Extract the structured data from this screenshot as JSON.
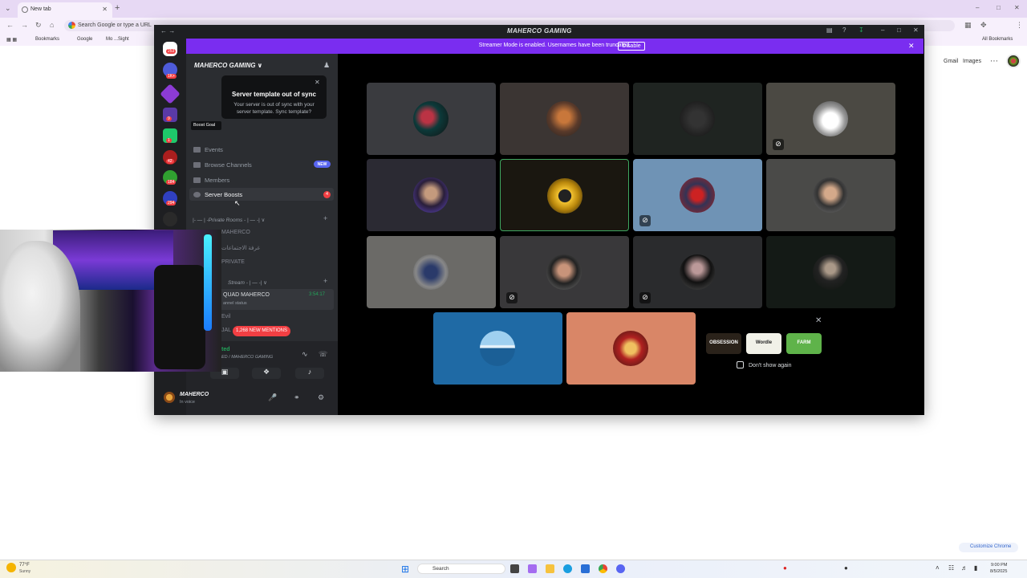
{
  "browser": {
    "tab_title": "New tab",
    "omnibox_placeholder": "Search Google or type a URL",
    "bookmarks": [
      "Bookmarks",
      "Google",
      "Mo ...Sight"
    ],
    "all_bookmarks": "All Bookmarks",
    "gmail": "Gmail",
    "images": "Images",
    "customize": "Customize Chrome"
  },
  "discord": {
    "window_title": "MAHERCO GAMING",
    "streamer_banner": "Streamer Mode is enabled. Usernames have been truncated.",
    "disable_label": "Disable",
    "server_name": "MAHERCO GAMING",
    "tooltip": {
      "title": "Server template out of sync",
      "body": "Your server is out of sync with your server template. Sync template?"
    },
    "boost_goal": "Boost Goal",
    "menu": {
      "events": "Events",
      "browse": "Browse Channels",
      "new_badge": "NEW",
      "members": "Members",
      "boosts": "Server Boosts",
      "boost_count": "4"
    },
    "categories": {
      "private": "|- — | -Private Rooms - | — -| ∨",
      "stream": "Stream - | — -| ∨"
    },
    "channels": [
      "MAHERCO",
      "غرفة الاجتماعات",
      "PRIVATE"
    ],
    "voice": {
      "name": "QUAD MAHERCO",
      "status": "annel status",
      "time": "3:54:17",
      "extra1": "Evil",
      "extra2": "JAL"
    },
    "mentions": "1,268 NEW MENTIONS",
    "rtc": {
      "label": "ted",
      "sub": "ED / MAHERCO GAMING"
    },
    "user": {
      "name": "MAHERCO",
      "status": "In voice"
    },
    "guild_badges": [
      "253",
      "1K+",
      "9",
      "1",
      "42",
      "184",
      "294"
    ],
    "activities": [
      "OBSESSION",
      "Wordle",
      "FARM"
    ],
    "dont_show": "Don't show again"
  },
  "taskbar": {
    "weather_temp": "77°F",
    "weather_status": "Sunny",
    "search": "Search",
    "time": "9:00 PM",
    "date": "8/5/2025"
  },
  "colors": {
    "discord_purple": "#7a2df0",
    "blurple": "#5865f2",
    "red": "#f23f43",
    "green": "#23a55a"
  }
}
